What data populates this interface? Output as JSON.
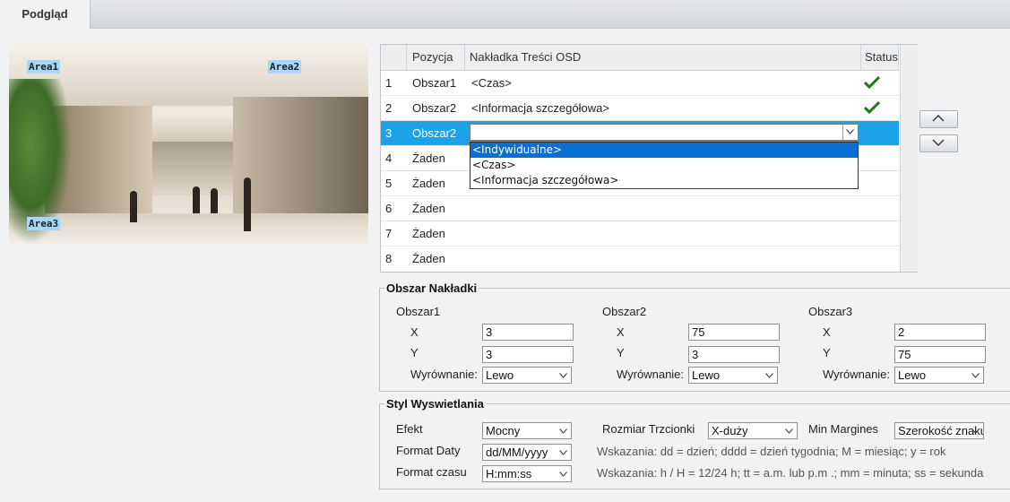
{
  "tabs": [
    {
      "label": "Podgląd"
    }
  ],
  "preview": {
    "areas": [
      {
        "label": "Area1"
      },
      {
        "label": "Area2"
      },
      {
        "label": "Area3"
      }
    ]
  },
  "osd_table": {
    "headers": {
      "pos": "Pozycja",
      "content": "Nakładka Treści OSD",
      "status": "Status"
    },
    "rows": [
      {
        "num": "1",
        "pos": "Obszar1",
        "content": "<Czas>",
        "status": "check"
      },
      {
        "num": "2",
        "pos": "Obszar2",
        "content": "<Informacja szczegółowa>",
        "status": "check"
      },
      {
        "num": "3",
        "pos": "Obszar2",
        "content": "",
        "status": ""
      },
      {
        "num": "4",
        "pos": "Żaden",
        "content": "",
        "status": ""
      },
      {
        "num": "5",
        "pos": "Żaden",
        "content": "",
        "status": ""
      },
      {
        "num": "6",
        "pos": "Żaden",
        "content": "",
        "status": ""
      },
      {
        "num": "7",
        "pos": "Żaden",
        "content": "",
        "status": ""
      },
      {
        "num": "8",
        "pos": "Żaden",
        "content": "",
        "status": ""
      }
    ],
    "dropdown_options": [
      "<Indywidualne>",
      "<Czas>",
      "<Informacja szczegółowa>"
    ],
    "dropdown_highlighted": "<Indywidualne>",
    "status_color": "#1a7a1a",
    "selected_row_color": "#1ca2e6"
  },
  "overlay_area": {
    "title": "Obszar Nakładki",
    "x_label": "X",
    "y_label": "Y",
    "align_label": "Wyrównanie:",
    "areas": [
      {
        "name": "Obszar1",
        "x": "3",
        "y": "3",
        "align": "Lewo"
      },
      {
        "name": "Obszar2",
        "x": "75",
        "y": "3",
        "align": "Lewo"
      },
      {
        "name": "Obszar3",
        "x": "2",
        "y": "75",
        "align": "Lewo"
      }
    ]
  },
  "display_style": {
    "title": "Styl Wyswietlania",
    "effect_label": "Efekt",
    "effect_value": "Mocny",
    "font_size_label": "Rozmiar Trzcionki",
    "font_size_value": "X-duży",
    "min_margin_label": "Min Margines",
    "min_margin_value": "Szerokość znaku",
    "date_format_label": "Format Daty",
    "date_format_value": "dd/MM/yyyy",
    "date_hint": "Wskazania: dd = dzień; dddd = dzień tygodnia; M = miesiąc; y = rok",
    "time_format_label": "Format czasu",
    "time_format_value": "H:mm:ss",
    "time_hint": "Wskazania: h / H = 12/24 h; tt = a.m. lub p.m .; mm = minuta; ss = sekunda"
  }
}
